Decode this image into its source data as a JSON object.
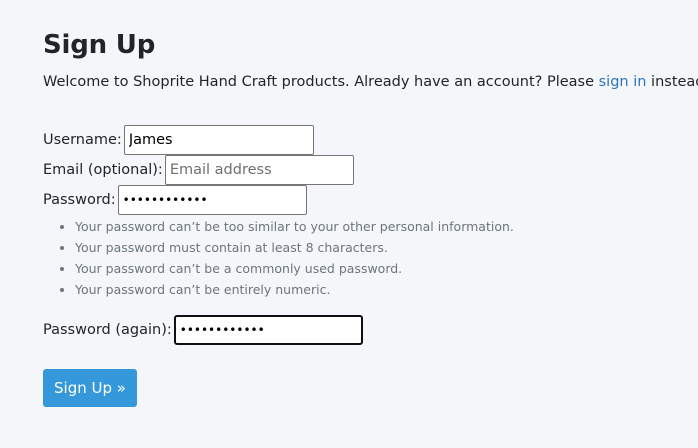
{
  "page": {
    "title": "Sign Up",
    "lead_prefix": "Welcome to Shoprite Hand Craft products. Already have an account? Please ",
    "lead_link": "sign in",
    "lead_suffix": " instead"
  },
  "form": {
    "username": {
      "label": "Username:",
      "value": "James"
    },
    "email": {
      "label": "Email (optional):",
      "value": "",
      "placeholder": "Email address"
    },
    "password": {
      "label": "Password:",
      "value": "••••••••••••"
    },
    "password_help": [
      "Your password can’t be too similar to your other personal information.",
      "Your password must contain at least 8 characters.",
      "Your password can’t be a commonly used password.",
      "Your password can’t be entirely numeric."
    ],
    "password2": {
      "label": "Password (again):",
      "value": "••••••••••••"
    },
    "submit_label": "Sign Up »"
  }
}
